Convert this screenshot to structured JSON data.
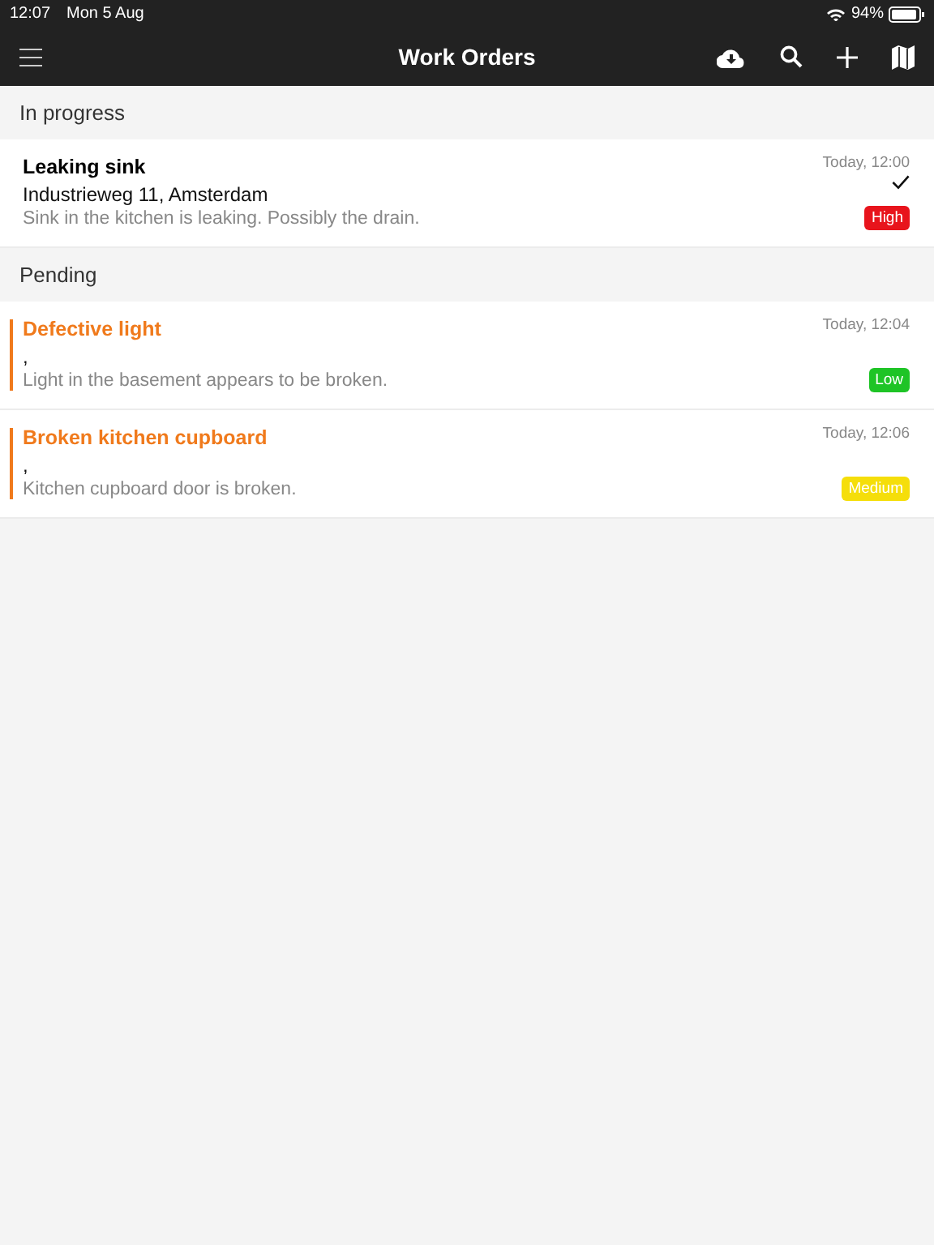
{
  "status_bar": {
    "time": "12:07",
    "date": "Mon 5 Aug",
    "battery": "94%"
  },
  "nav_bar": {
    "title": "Work Orders"
  },
  "sections": [
    {
      "title": "In progress",
      "orders": [
        {
          "title": "Leaking sink",
          "address": "Industrieweg 11, Amsterdam",
          "description": "Sink in the kitchen is leaking. Possibly the drain.",
          "time": "Today, 12:00",
          "done": true,
          "highlighted": false,
          "priority": "High",
          "color": "#e8141c"
        }
      ]
    },
    {
      "title": "Pending",
      "orders": [
        {
          "title": "Defective light",
          "address": ",",
          "description": "Light in the basement appears to be broken.",
          "time": "Today, 12:04",
          "done": false,
          "highlighted": true,
          "priority": "Low",
          "color": "#1ec426"
        },
        {
          "title": "Broken kitchen cupboard",
          "address": ",",
          "description": "Kitchen cupboard door is broken.",
          "time": "Today, 12:06",
          "done": false,
          "highlighted": true,
          "priority": "Medium",
          "color": "#f5de0a"
        }
      ]
    }
  ]
}
